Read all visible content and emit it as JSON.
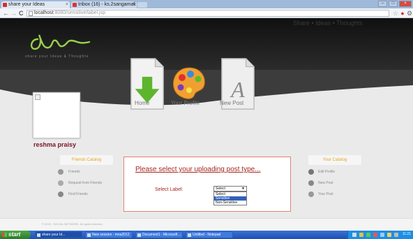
{
  "browser": {
    "tabs": [
      {
        "label": "share your Ideas",
        "active": true
      },
      {
        "label": "Inbox (16) - ks.2sangamali",
        "active": false
      }
    ],
    "window_controls": {
      "minimize": "–",
      "maximize": "□",
      "close": "×"
    },
    "url_host": "localhost",
    "url_path": ":8080/sensitive/label.jsp",
    "nav": {
      "back": "←",
      "forward": "→",
      "reload": "C"
    }
  },
  "site": {
    "tagline": "share your Ideas & Thoughts",
    "header_right": "Share • Ideas • Thoughts",
    "nav": [
      {
        "label": "Home",
        "icon": "download-icon"
      },
      {
        "label": "Your Profile",
        "icon": "palette-icon"
      },
      {
        "label": "New Post",
        "icon": "document-icon"
      }
    ],
    "username": "reshma praisy",
    "friends_catalog": {
      "title": "Friends Catalog",
      "items": [
        "Friends",
        "Request from Friends",
        "Find Friends"
      ]
    },
    "your_catalog": {
      "title": "Your Catalog",
      "items": [
        "Edit Profile",
        "New Post",
        "Your Post"
      ]
    },
    "form": {
      "prompt": "Please select your uploading post type...",
      "label": "Select Label:",
      "selected": "Select",
      "options": [
        "Select",
        "Sensitive",
        "Non-Sensitive"
      ],
      "highlighted_index": 1
    },
    "footer": "© 2015 - SOCIAL NETWORK. All rights reserved."
  },
  "taskbar": {
    "start": "start",
    "tasks": [
      {
        "label": "share your Id...",
        "active": true
      },
      {
        "label": "New session - mea2012",
        "active": false
      },
      {
        "label": "Document1 - Microsoft ...",
        "active": false
      },
      {
        "label": "Untitled - Notepad",
        "active": false
      }
    ],
    "clock": "11:21"
  },
  "colors": {
    "accent": "#a4261f",
    "username": "#7a1626",
    "catalog_title": "#e7a321"
  }
}
